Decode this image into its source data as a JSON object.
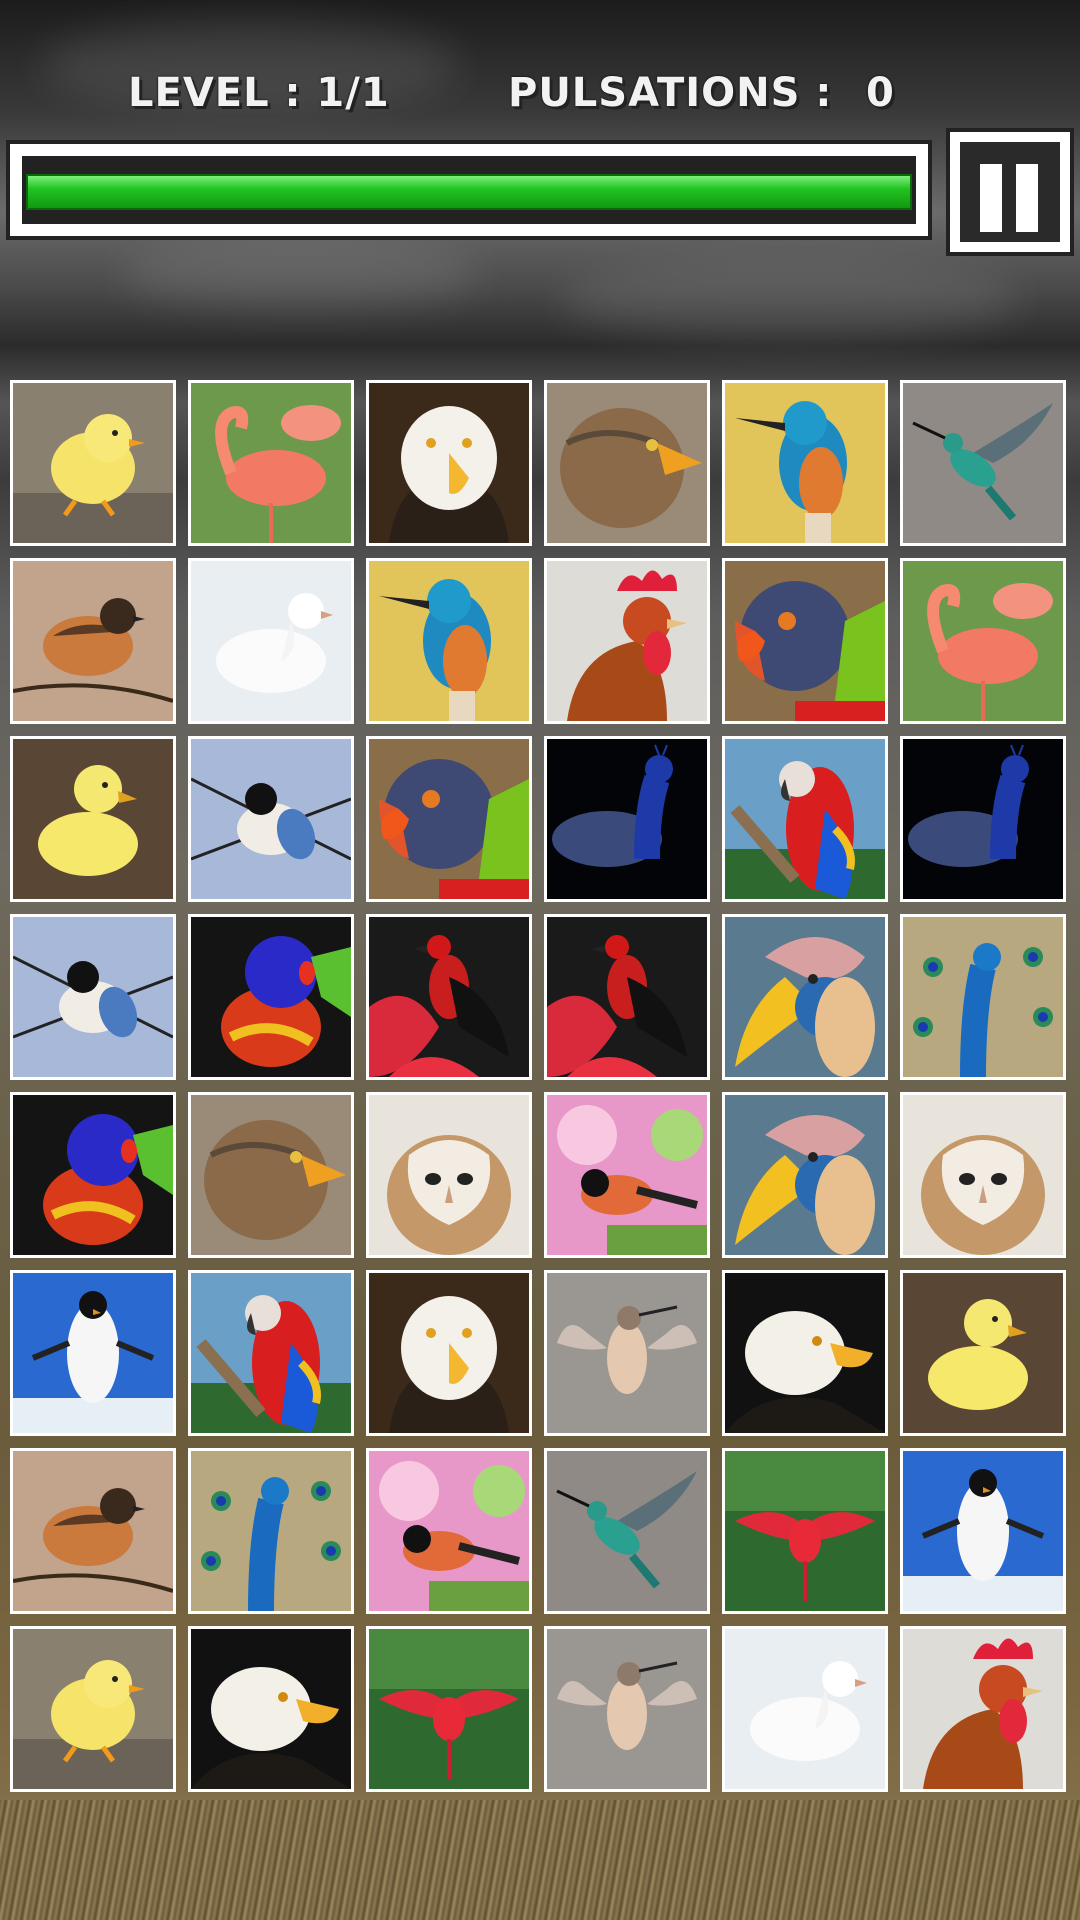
{
  "hud": {
    "level_label": "LEVEL : 1/1",
    "pulsations_label": "PULSATIONS :",
    "pulsations_value": "0",
    "progress": 1.0
  },
  "board": {
    "rows": 8,
    "cols": 6,
    "tiles": [
      [
        "chick",
        "flamingo",
        "bald-eagle",
        "kite",
        "kingfisher",
        "hummingbird"
      ],
      [
        "sparrow",
        "dove",
        "kingfisher",
        "rooster",
        "lorikeet-head",
        "flamingo"
      ],
      [
        "duckling",
        "tit",
        "lorikeet-head",
        "peacock-dark",
        "macaw",
        "peacock-dark"
      ],
      [
        "tit",
        "lorikeet",
        "red-bird",
        "red-bird",
        "hornbill",
        "peacock-tail"
      ],
      [
        "lorikeet",
        "kite",
        "barn-owl",
        "bullfinch",
        "hornbill",
        "barn-owl"
      ],
      [
        "penguin",
        "macaw",
        "bald-eagle",
        "hummingbird-hover",
        "bald-eagle-side",
        "duckling"
      ],
      [
        "sparrow",
        "peacock-tail",
        "bullfinch",
        "hummingbird",
        "scarlet-ibis",
        "penguin"
      ],
      [
        "chick",
        "bald-eagle-side",
        "scarlet-ibis",
        "hummingbird-hover",
        "dove",
        "rooster"
      ]
    ]
  }
}
